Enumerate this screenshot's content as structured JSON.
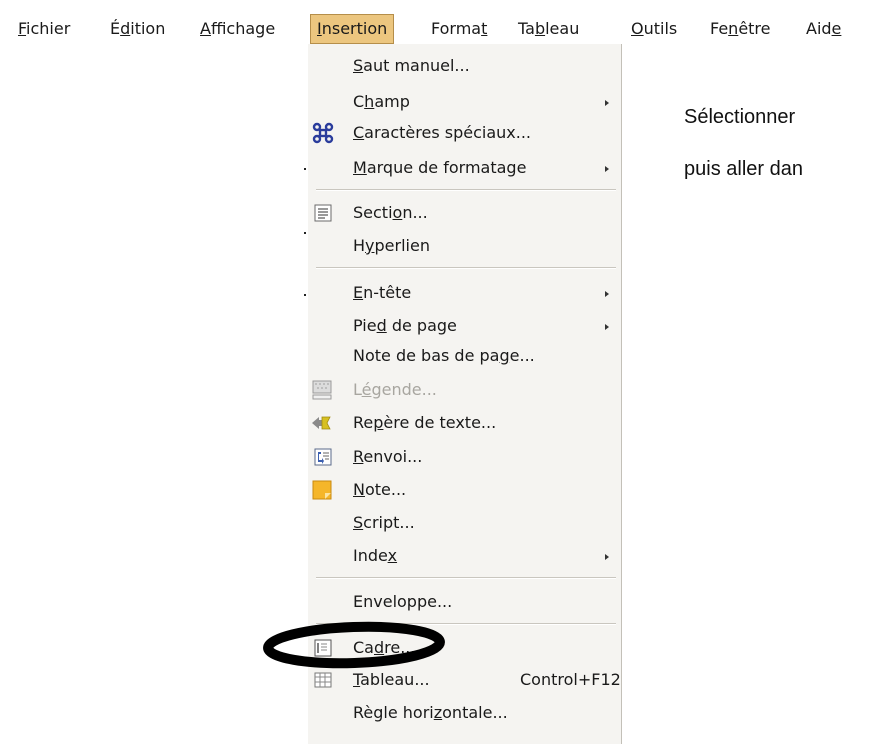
{
  "menubar": {
    "items": [
      {
        "pre": "",
        "mn": "F",
        "post": "ichier"
      },
      {
        "pre": "É",
        "mn": "d",
        "post": "ition"
      },
      {
        "pre": "",
        "mn": "A",
        "post": "ffichage"
      },
      {
        "pre": "",
        "mn": "I",
        "post": "nsertion"
      },
      {
        "pre": "Forma",
        "mn": "t",
        "post": ""
      },
      {
        "pre": "Ta",
        "mn": "b",
        "post": "leau"
      },
      {
        "pre": "",
        "mn": "O",
        "post": "utils"
      },
      {
        "pre": "Fe",
        "mn": "n",
        "post": "être"
      },
      {
        "pre": "Aid",
        "mn": "e",
        "post": ""
      }
    ]
  },
  "insertion_menu": {
    "items": [
      {
        "pre": "",
        "mn": "S",
        "post": "aut manuel..."
      },
      {
        "pre": "C",
        "mn": "h",
        "post": "amp"
      },
      {
        "pre": "",
        "mn": "C",
        "post": "aractères spéciaux..."
      },
      {
        "pre": "",
        "mn": "M",
        "post": "arque de formatage"
      },
      {
        "pre": "Secti",
        "mn": "o",
        "post": "n..."
      },
      {
        "pre": "H",
        "mn": "y",
        "post": "perlien"
      },
      {
        "pre": "",
        "mn": "E",
        "post": "n-tête"
      },
      {
        "pre": "Pie",
        "mn": "d",
        "post": " de page"
      },
      {
        "pre": "Note de bas de pa",
        "mn": "g",
        "post": "e..."
      },
      {
        "pre": "L",
        "mn": "é",
        "post": "gende..."
      },
      {
        "pre": "Re",
        "mn": "p",
        "post": "ère de texte..."
      },
      {
        "pre": "",
        "mn": "R",
        "post": "envoi..."
      },
      {
        "pre": "",
        "mn": "N",
        "post": "ote..."
      },
      {
        "pre": "",
        "mn": "S",
        "post": "cript..."
      },
      {
        "pre": "Inde",
        "mn": "x",
        "post": ""
      },
      {
        "pre": "Enveloppe...",
        "mn": "",
        "post": ""
      },
      {
        "pre": "Ca",
        "mn": "d",
        "post": "re..."
      },
      {
        "pre": "",
        "mn": "T",
        "post": "ableau..."
      },
      {
        "pre": "Règle hori",
        "mn": "z",
        "post": "ontale..."
      }
    ],
    "table_shortcut": "Control+F12"
  },
  "instruction": {
    "line1": "Sélectionner",
    "line2": "puis aller dan"
  },
  "icons": {
    "special_chars": "command-icon",
    "section": "section-icon",
    "caption": "caption-icon",
    "bookmark": "bookmark-icon",
    "cross_reference": "cross-reference-icon",
    "note": "note-icon",
    "frame": "frame-icon",
    "table": "table-icon"
  },
  "colors": {
    "menu_highlight": "#ecc67f",
    "menu_background": "#f5f4f1",
    "note_icon": "#f5b62a",
    "bookmark_icon": "#d7c021",
    "ellipse": "#000000"
  }
}
